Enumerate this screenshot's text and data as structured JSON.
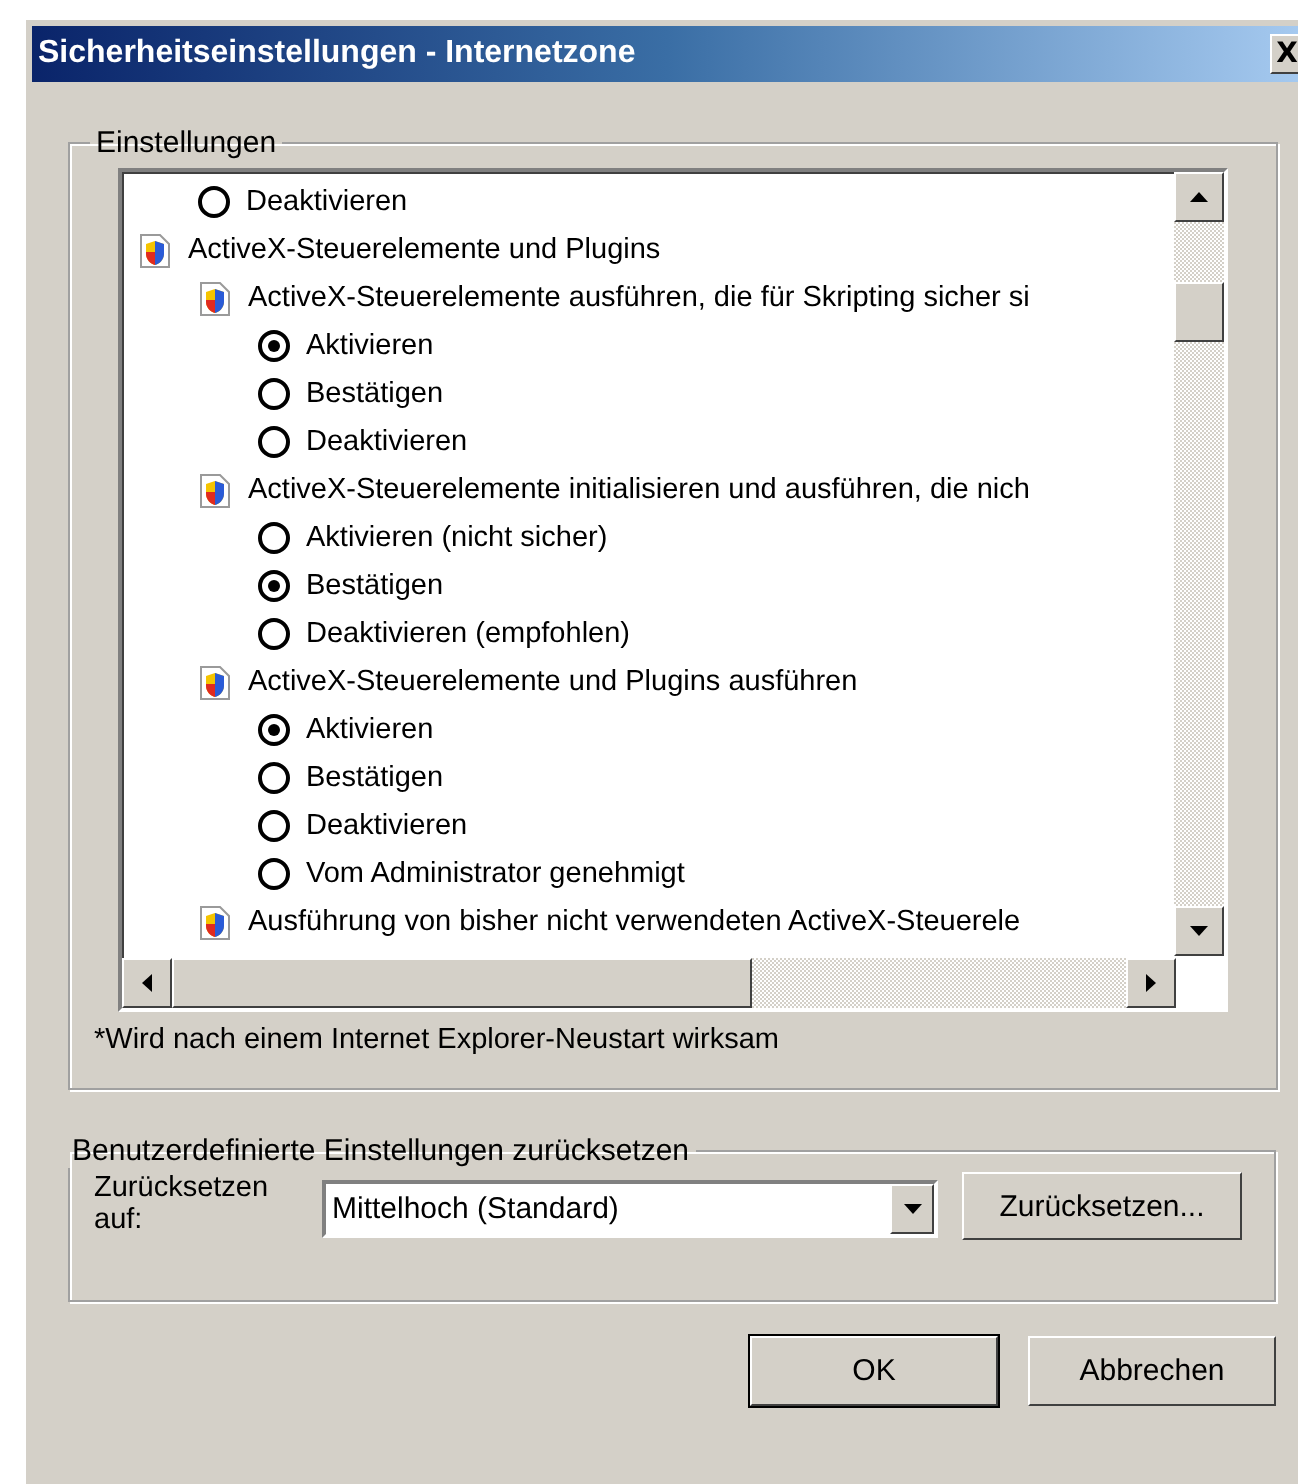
{
  "window": {
    "title": "Sicherheitseinstellungen - Internetzone",
    "close": "X"
  },
  "settings": {
    "title": "Einstellungen",
    "items": [
      {
        "kind": "radio",
        "label": "Deaktivieren",
        "selected": false
      },
      {
        "kind": "category",
        "label": "ActiveX-Steuerelemente und Plugins",
        "children": [
          {
            "kind": "setting",
            "label": "ActiveX-Steuerelemente ausführen, die für Skripting sicher si",
            "children": [
              {
                "kind": "radio",
                "label": "Aktivieren",
                "selected": true
              },
              {
                "kind": "radio",
                "label": "Bestätigen",
                "selected": false
              },
              {
                "kind": "radio",
                "label": "Deaktivieren",
                "selected": false
              }
            ]
          },
          {
            "kind": "setting",
            "label": "ActiveX-Steuerelemente initialisieren und ausführen, die nich",
            "children": [
              {
                "kind": "radio",
                "label": "Aktivieren (nicht sicher)",
                "selected": false
              },
              {
                "kind": "radio",
                "label": "Bestätigen",
                "selected": true
              },
              {
                "kind": "radio",
                "label": "Deaktivieren (empfohlen)",
                "selected": false
              }
            ]
          },
          {
            "kind": "setting",
            "label": "ActiveX-Steuerelemente und Plugins ausführen",
            "children": [
              {
                "kind": "radio",
                "label": "Aktivieren",
                "selected": true
              },
              {
                "kind": "radio",
                "label": "Bestätigen",
                "selected": false
              },
              {
                "kind": "radio",
                "label": "Deaktivieren",
                "selected": false
              },
              {
                "kind": "radio",
                "label": "Vom Administrator genehmigt",
                "selected": false
              }
            ]
          },
          {
            "kind": "setting",
            "label": "Ausführung von bisher nicht verwendeten ActiveX-Steuerele"
          }
        ]
      }
    ],
    "note": "*Wird nach einem Internet Explorer-Neustart wirksam"
  },
  "reset": {
    "title": "Benutzerdefinierte Einstellungen zurücksetzen",
    "label": "Zurücksetzen auf:",
    "value": "Mittelhoch (Standard)",
    "button": "Zurücksetzen..."
  },
  "buttons": [
    "OK",
    "Abbrechen"
  ]
}
